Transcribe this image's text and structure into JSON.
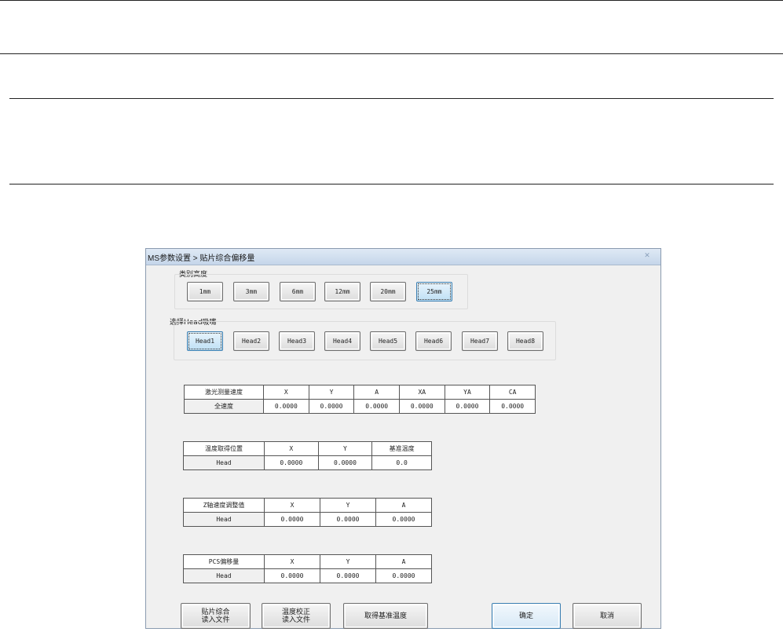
{
  "window": {
    "title": "MS参数设置 > 贴片综合偏移量"
  },
  "speed_group": {
    "label": "类别高度",
    "buttons": [
      "1mm",
      "3mm",
      "6mm",
      "12mm",
      "20mm",
      "25mm"
    ],
    "selected": "25mm"
  },
  "head_group": {
    "label": "选择Head吸嘴",
    "buttons": [
      "Head1",
      "Head2",
      "Head3",
      "Head4",
      "Head5",
      "Head6",
      "Head7",
      "Head8"
    ],
    "selected": "Head1"
  },
  "laser_table": {
    "headers": [
      "激光测量速度",
      "X",
      "Y",
      "A",
      "XA",
      "YA",
      "CA"
    ],
    "row": [
      "全速度",
      "0.0000",
      "0.0000",
      "0.0000",
      "0.0000",
      "0.0000",
      "0.0000"
    ]
  },
  "temp_pos_table": {
    "headers": [
      "温度取得位置",
      "X",
      "Y",
      "基准温度"
    ],
    "row": [
      "Head",
      "0.0000",
      "0.0000",
      "0.0"
    ]
  },
  "z_speed_table": {
    "headers": [
      "Z轴速度调整值",
      "X",
      "Y",
      "A"
    ],
    "row": [
      "Head",
      "0.0000",
      "0.0000",
      "0.0000"
    ]
  },
  "pcs_table": {
    "headers": [
      "PCS偏移量",
      "X",
      "Y",
      "A"
    ],
    "row": [
      "Head",
      "0.0000",
      "0.0000",
      "0.0000"
    ]
  },
  "footer": {
    "import_placement": [
      "贴片综合",
      "读入文件"
    ],
    "import_temp": [
      "温度校正",
      "读入文件"
    ],
    "get_base_temp": "取得基准温度",
    "ok": "确定",
    "cancel": "取消"
  }
}
